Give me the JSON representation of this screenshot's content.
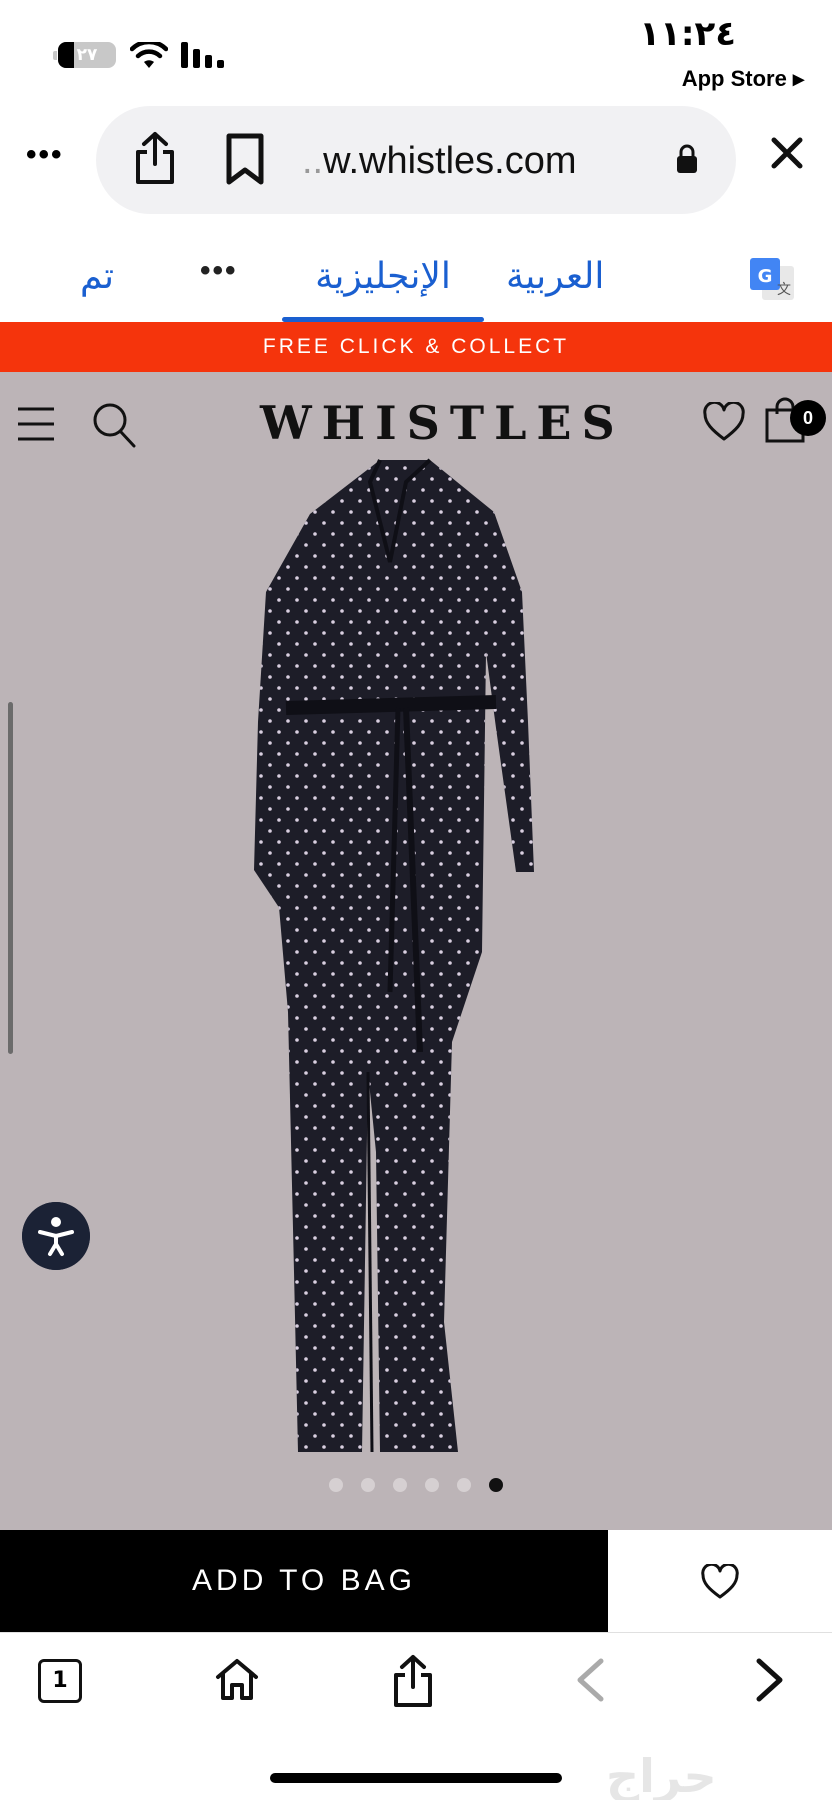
{
  "status_bar": {
    "time": "١١:٢٤",
    "back_to_app": "App Store ▸",
    "battery_percent": "٢٧",
    "battery_level": 0.27
  },
  "address_bar": {
    "url_prefix": "..",
    "url": "w.whistles.com"
  },
  "translate_bar": {
    "done": "تم",
    "more": "•••",
    "translated_language": "الإنجليزية",
    "original_language": "العربية"
  },
  "promo_banner": "FREE CLICK & COLLECT",
  "site_header": {
    "logo": "WHISTLES",
    "bag_count": "0"
  },
  "gallery": {
    "total_images": 6,
    "active_index": 5
  },
  "actions": {
    "add_to_bag": "ADD TO BAG"
  },
  "toolbar": {
    "tab_count": "1"
  },
  "colors": {
    "promo": "#f5340c",
    "translate_accent": "#1a5fd0",
    "product_background": "#bcb4b7"
  }
}
